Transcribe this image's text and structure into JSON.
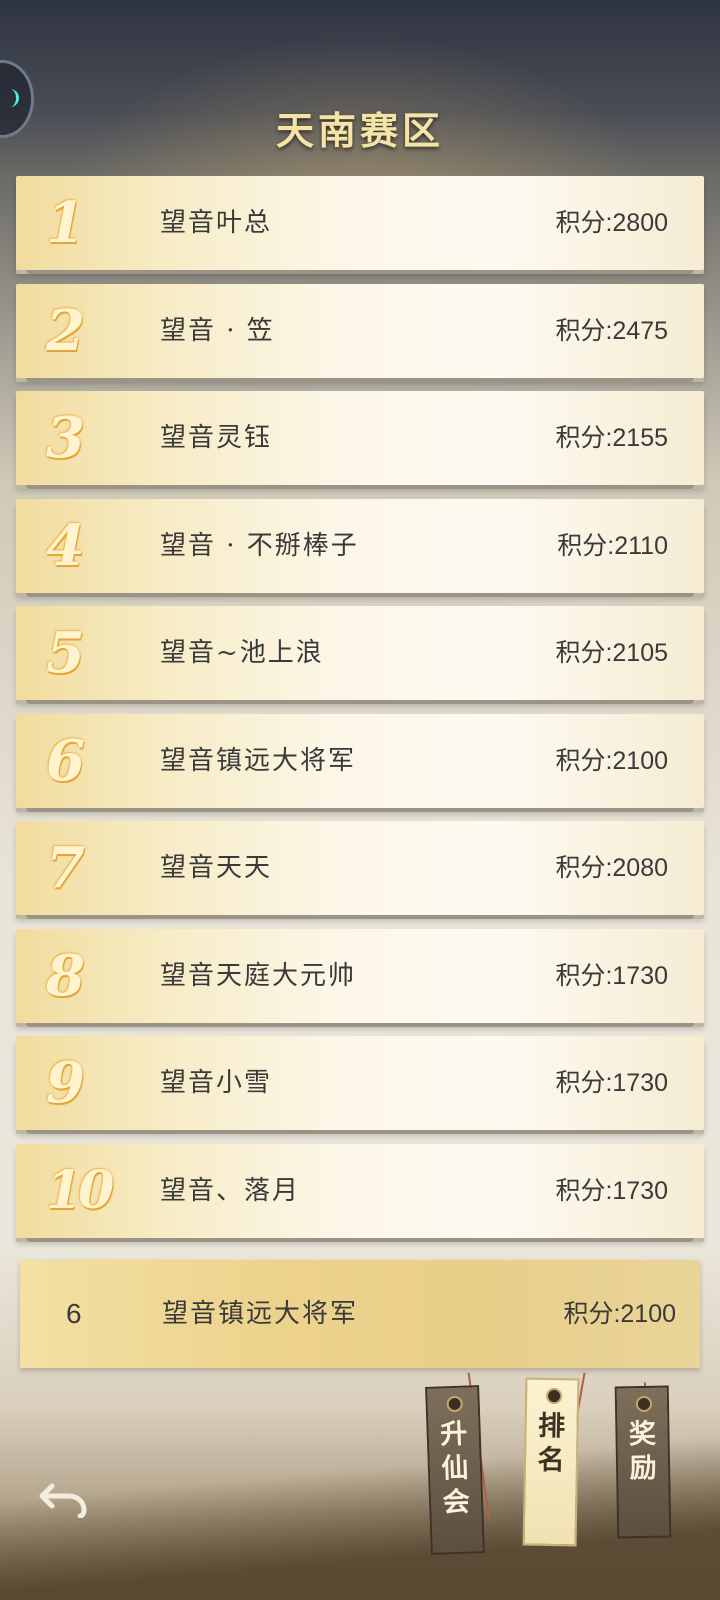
{
  "header": {
    "title": "天南赛区"
  },
  "rankings": [
    {
      "rank": "1",
      "name": "望音叶总",
      "score": "积分:2800"
    },
    {
      "rank": "2",
      "name": "望音 · 笠",
      "score": "积分:2475"
    },
    {
      "rank": "3",
      "name": "望音灵钰",
      "score": "积分:2155"
    },
    {
      "rank": "4",
      "name": "望音 · 不掰棒子",
      "score": "积分:2110"
    },
    {
      "rank": "5",
      "name": "望音~池上浪",
      "score": "积分:2105"
    },
    {
      "rank": "6",
      "name": "望音镇远大将军",
      "score": "积分:2100"
    },
    {
      "rank": "7",
      "name": "望音天天",
      "score": "积分:2080"
    },
    {
      "rank": "8",
      "name": "望音天庭大元帅",
      "score": "积分:1730"
    },
    {
      "rank": "9",
      "name": "望音小雪",
      "score": "积分:1730"
    },
    {
      "rank": "10",
      "name": "望音、落月",
      "score": "积分:1730"
    }
  ],
  "my_rank": {
    "rank": "6",
    "name": "望音镇远大将军",
    "score": "积分:2100"
  },
  "tabs": [
    {
      "label": "升仙会",
      "selected": false
    },
    {
      "label": "排名",
      "selected": true
    },
    {
      "label": "奖励",
      "selected": false
    }
  ],
  "icons": {
    "back": "back-arrow-icon",
    "corner": "menu-ring-icon"
  },
  "colors": {
    "title": "#f6e3a6",
    "rank_numeral": "#fff4cf",
    "accent_cyan": "#4ff0e6"
  }
}
